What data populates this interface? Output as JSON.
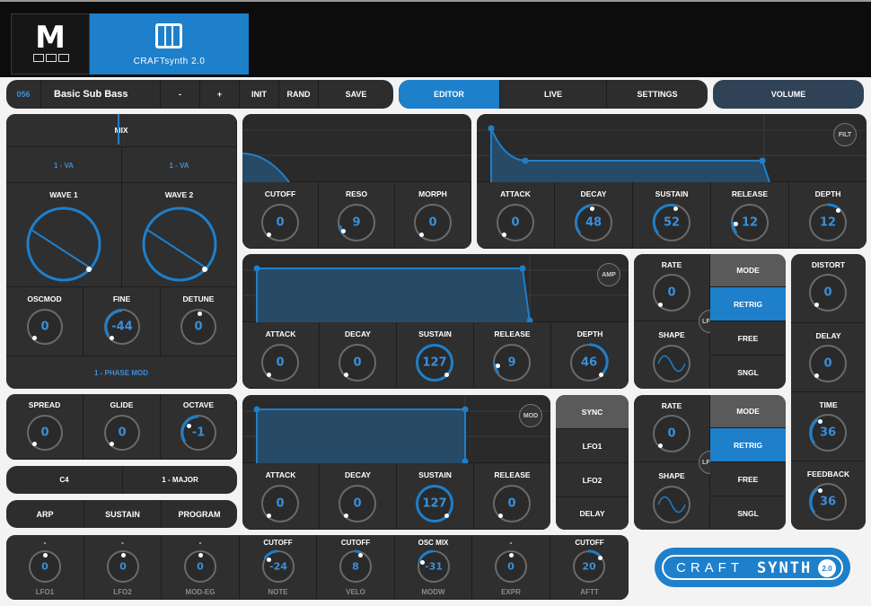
{
  "header": {
    "logo": "M",
    "app_label": "CRAFTsynth 2.0"
  },
  "preset": {
    "number": "056",
    "name": "Basic Sub Bass",
    "minus": "-",
    "plus": "+",
    "init": "INIT",
    "rand": "RAND",
    "save": "SAVE"
  },
  "nav": {
    "editor": "EDITOR",
    "live": "LIVE",
    "settings": "SETTINGS",
    "volume": "VOLUME"
  },
  "osc": {
    "mix": "MIX",
    "osc1_type": "1 - VA",
    "osc2_type": "1 - VA",
    "wave1": "WAVE 1",
    "wave2": "WAVE 2",
    "oscmod": "OSCMOD",
    "oscmod_val": "0",
    "fine": "FINE",
    "fine_val": "-44",
    "detune": "DETUNE",
    "detune_val": "0",
    "mod_type": "1 - PHASE MOD"
  },
  "perf": {
    "spread": "SPREAD",
    "spread_val": "0",
    "glide": "GLIDE",
    "glide_val": "0",
    "octave": "OCTAVE",
    "octave_val": "-1"
  },
  "scale": {
    "root": "C4",
    "mode": "1 - MAJOR"
  },
  "tabs2": {
    "arp": "ARP",
    "sustain": "SUSTAIN",
    "program": "PROGRAM"
  },
  "filter": {
    "cutoff": "CUTOFF",
    "cutoff_val": "0",
    "reso": "RESO",
    "reso_val": "9",
    "morph": "MORPH",
    "morph_val": "0"
  },
  "filt_env": {
    "tag": "FILT",
    "attack": "ATTACK",
    "attack_val": "0",
    "decay": "DECAY",
    "decay_val": "48",
    "sustain": "SUSTAIN",
    "sustain_val": "52",
    "release": "RELEASE",
    "release_val": "12",
    "depth": "DEPTH",
    "depth_val": "12"
  },
  "amp_env": {
    "tag": "AMP",
    "attack": "ATTACK",
    "attack_val": "0",
    "decay": "DECAY",
    "decay_val": "0",
    "sustain": "SUSTAIN",
    "sustain_val": "127",
    "release": "RELEASE",
    "release_val": "9",
    "depth": "DEPTH",
    "depth_val": "46"
  },
  "mod_env": {
    "tag": "MOD",
    "attack": "ATTACK",
    "attack_val": "0",
    "decay": "DECAY",
    "decay_val": "0",
    "sustain": "SUSTAIN",
    "sustain_val": "127",
    "release": "RELEASE",
    "release_val": "0"
  },
  "sync": {
    "title": "SYNC",
    "lfo1": "LFO1",
    "lfo2": "LFO2",
    "delay": "DELAY"
  },
  "lfo1": {
    "tag": "LFO1",
    "rate": "RATE",
    "rate_val": "0",
    "shape": "SHAPE",
    "mode": "MODE",
    "retrig": "RETRIG",
    "free": "FREE",
    "sngl": "SNGL"
  },
  "lfo2": {
    "tag": "LFO2",
    "rate": "RATE",
    "rate_val": "0",
    "shape": "SHAPE",
    "mode": "MODE",
    "retrig": "RETRIG",
    "free": "FREE",
    "sngl": "SNGL"
  },
  "fx": {
    "distort": "DISTORT",
    "distort_val": "0",
    "delay": "DELAY",
    "delay_val": "0",
    "time": "TIME",
    "time_val": "36",
    "feedback": "FEEDBACK",
    "feedback_val": "36"
  },
  "mod_matrix": [
    {
      "dest": "-",
      "val": "0",
      "src": "LFO1"
    },
    {
      "dest": "-",
      "val": "0",
      "src": "LFO2"
    },
    {
      "dest": "-",
      "val": "0",
      "src": "MOD-EG"
    },
    {
      "dest": "CUTOFF",
      "val": "-24",
      "src": "NOTE"
    },
    {
      "dest": "CUTOFF",
      "val": "8",
      "src": "VELO"
    },
    {
      "dest": "OSC MIX",
      "val": "-31",
      "src": "MODW"
    },
    {
      "dest": "-",
      "val": "0",
      "src": "EXPR"
    },
    {
      "dest": "CUTOFF",
      "val": "20",
      "src": "AFTT"
    }
  ],
  "brand": {
    "craft": "CRAFT",
    "synth": "SYNTH",
    "version": "2.0"
  },
  "colors": {
    "accent": "#1e7fcb",
    "panel": "#2c2c2c",
    "value": "#3a8fd8"
  }
}
